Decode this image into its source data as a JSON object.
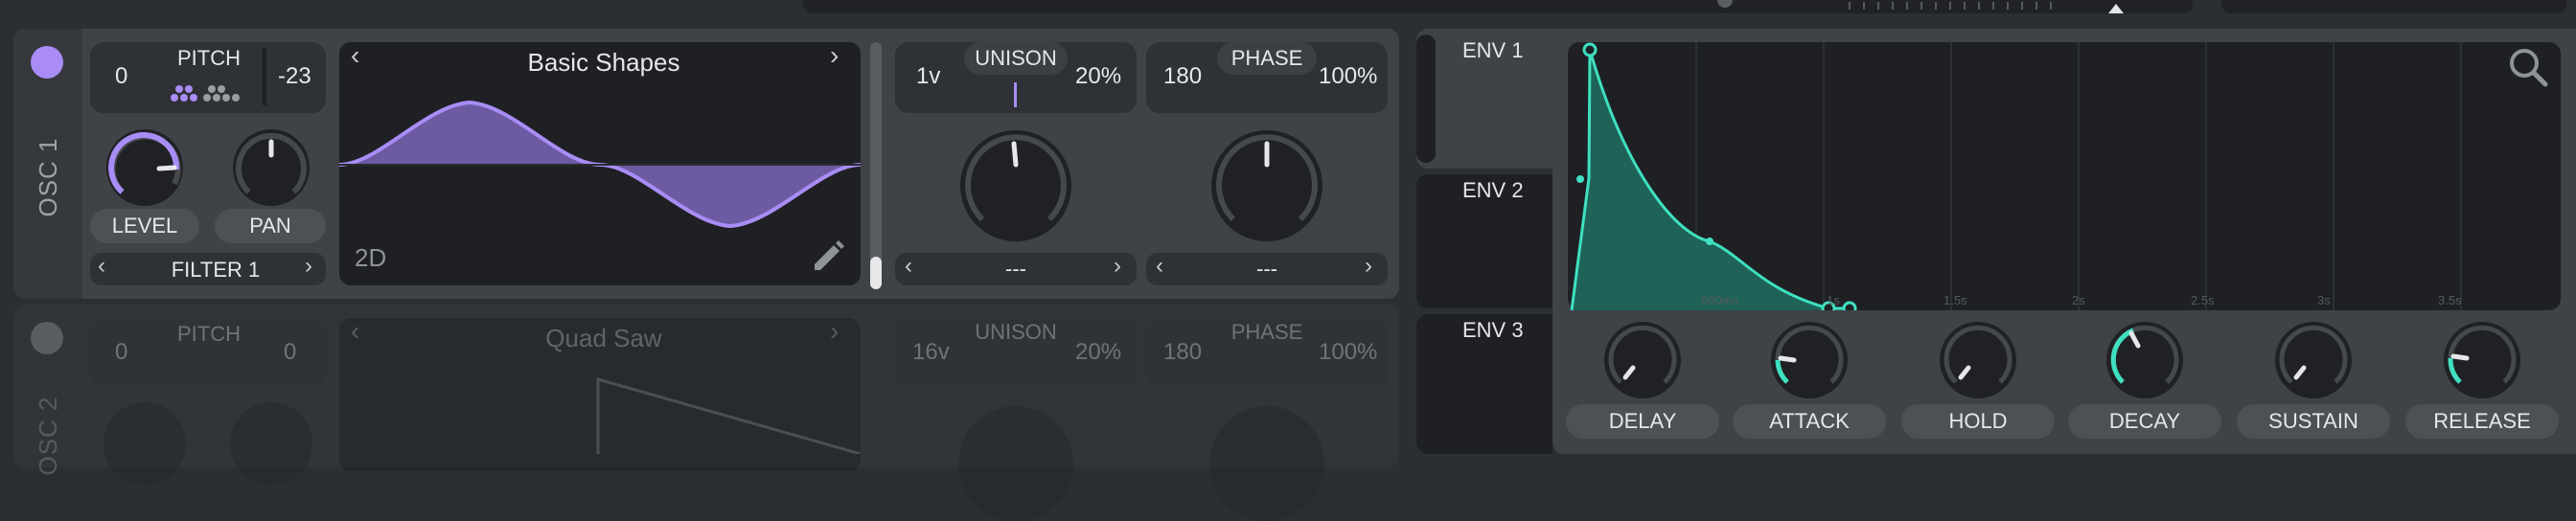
{
  "colors": {
    "osc_accent": "#a98cf5",
    "env_accent": "#3fe0c0"
  },
  "osc1": {
    "label": "OSC 1",
    "pitch": {
      "label": "PITCH",
      "left": "0",
      "right": "-23"
    },
    "level_label": "LEVEL",
    "pan_label": "PAN",
    "filter": "FILTER 1",
    "wavetable": {
      "name": "Basic Shapes",
      "mode": "2D",
      "edit_icon": "pencil-icon"
    },
    "unison": {
      "label": "UNISON",
      "voices": "1v",
      "detune": "20%",
      "selector": "---"
    },
    "phase": {
      "label": "PHASE",
      "value": "180",
      "rand": "100%",
      "selector": "---"
    }
  },
  "osc2": {
    "label": "OSC 2",
    "pitch": {
      "label": "PITCH",
      "left": "0",
      "right": "0"
    },
    "wavetable": {
      "name": "Quad Saw"
    },
    "unison": {
      "label": "UNISON",
      "voices": "16v",
      "detune": "20%"
    },
    "phase": {
      "label": "PHASE",
      "value": "180",
      "rand": "100%"
    }
  },
  "env": {
    "tabs": [
      "ENV 1",
      "ENV 2",
      "ENV 3"
    ],
    "time_ticks": [
      "500ms",
      "1s",
      "1.5s",
      "2s",
      "2.5s",
      "3s",
      "3.5s"
    ],
    "knobs": [
      "DELAY",
      "ATTACK",
      "HOLD",
      "DECAY",
      "SUSTAIN",
      "RELEASE"
    ],
    "search_icon": "magnifier-icon"
  }
}
